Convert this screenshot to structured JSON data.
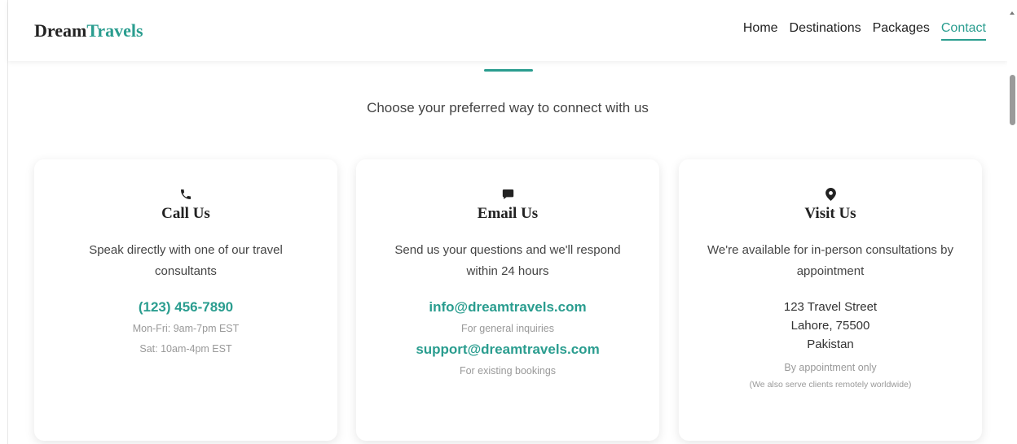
{
  "header": {
    "logo_part1": "Dream",
    "logo_part2": "Travels",
    "nav": [
      "Home",
      "Destinations",
      "Packages",
      "Contact"
    ],
    "active_nav": "Contact"
  },
  "subtitle": "Choose your preferred way to connect with us",
  "cards": {
    "call": {
      "icon": "phone-icon",
      "title": "Call Us",
      "description": "Speak directly with one of our travel consultants",
      "phone": "(123) 456-7890",
      "hours_weekday": "Mon-Fri: 9am-7pm EST",
      "hours_saturday": "Sat: 10am-4pm EST"
    },
    "email": {
      "icon": "chat-icon",
      "title": "Email Us",
      "description": "Send us your questions and we'll respond within 24 hours",
      "email_general": "info@dreamtravels.com",
      "email_general_note": "For general inquiries",
      "email_support": "support@dreamtravels.com",
      "email_support_note": "For existing bookings"
    },
    "visit": {
      "icon": "map-marker-icon",
      "title": "Visit Us",
      "description": "We're available for in-person consultations by appointment",
      "address_line1": "123 Travel Street",
      "address_line2": "Lahore, 75500",
      "address_line3": "Pakistan",
      "note": "By appointment only",
      "remote_note": "(We also serve clients remotely worldwide)"
    }
  },
  "colors": {
    "accent": "#2a9d8f",
    "text": "#333333",
    "muted": "#999999"
  }
}
